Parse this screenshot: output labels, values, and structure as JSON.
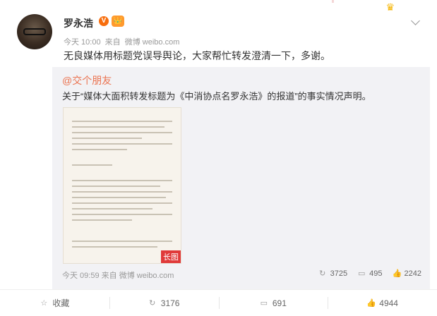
{
  "post": {
    "author": "罗永浩",
    "v_badge": "V",
    "member_badge": "👑",
    "time": "今天 10:00",
    "via": "来自",
    "source": "微博 weibo.com",
    "text": "无良媒体用标题党误导舆论，大家帮忙转发澄清一下，多谢。"
  },
  "quote": {
    "author": "@交个朋友",
    "text": "关于“媒体大面积转发标题为《中消协点名罗永浩》的报道”的事实情况声明。",
    "image_tag": "长图",
    "time": "今天 09:59",
    "via": "来自",
    "source": "微博 weibo.com",
    "stats": {
      "reposts": "3725",
      "comments": "495",
      "likes": "2242"
    }
  },
  "actions": {
    "favorite": "收藏",
    "repost": "3176",
    "comment": "691",
    "like": "4944"
  },
  "colors": {
    "accent": "#eb7350",
    "vip_orange": "#f86e0e"
  }
}
